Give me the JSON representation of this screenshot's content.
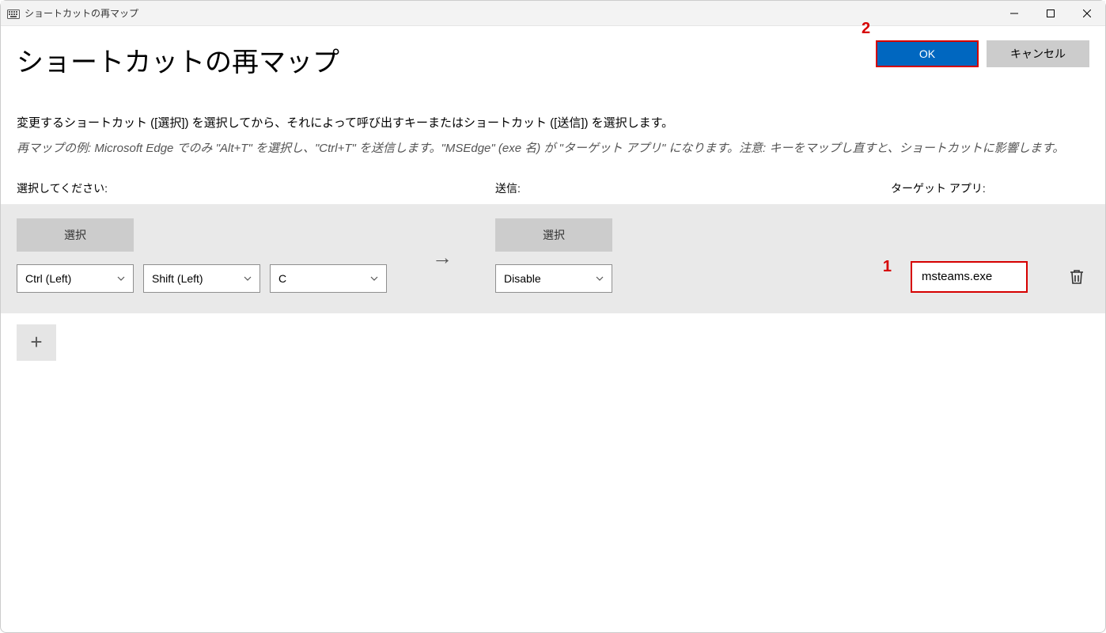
{
  "window": {
    "title": "ショートカットの再マップ"
  },
  "header": {
    "page_title": "ショートカットの再マップ",
    "ok_label": "OK",
    "cancel_label": "キャンセル"
  },
  "annotations": {
    "marker_1": "1",
    "marker_2": "2"
  },
  "instructions": {
    "main": "変更するショートカット ([選択]) を選択してから、それによって呼び出すキーまたはショートカット ([送信]) を選択します。",
    "example": "再マップの例: Microsoft Edge でのみ \"Alt+T\" を選択し、\"Ctrl+T\" を送信します。\"MSEdge\" (exe 名) が \"ターゲット アプリ\" になります。注意: キーをマップし直すと、ショートカットに影響します。"
  },
  "columns": {
    "select": "選択してください:",
    "send": "送信:",
    "target": "ターゲット アプリ:"
  },
  "row": {
    "select_button": "選択",
    "send_select_button": "選択",
    "key1": "Ctrl (Left)",
    "key2": "Shift (Left)",
    "key3": "C",
    "send_key": "Disable",
    "arrow": "→",
    "target_app": "msteams.exe"
  },
  "add_button": "+"
}
